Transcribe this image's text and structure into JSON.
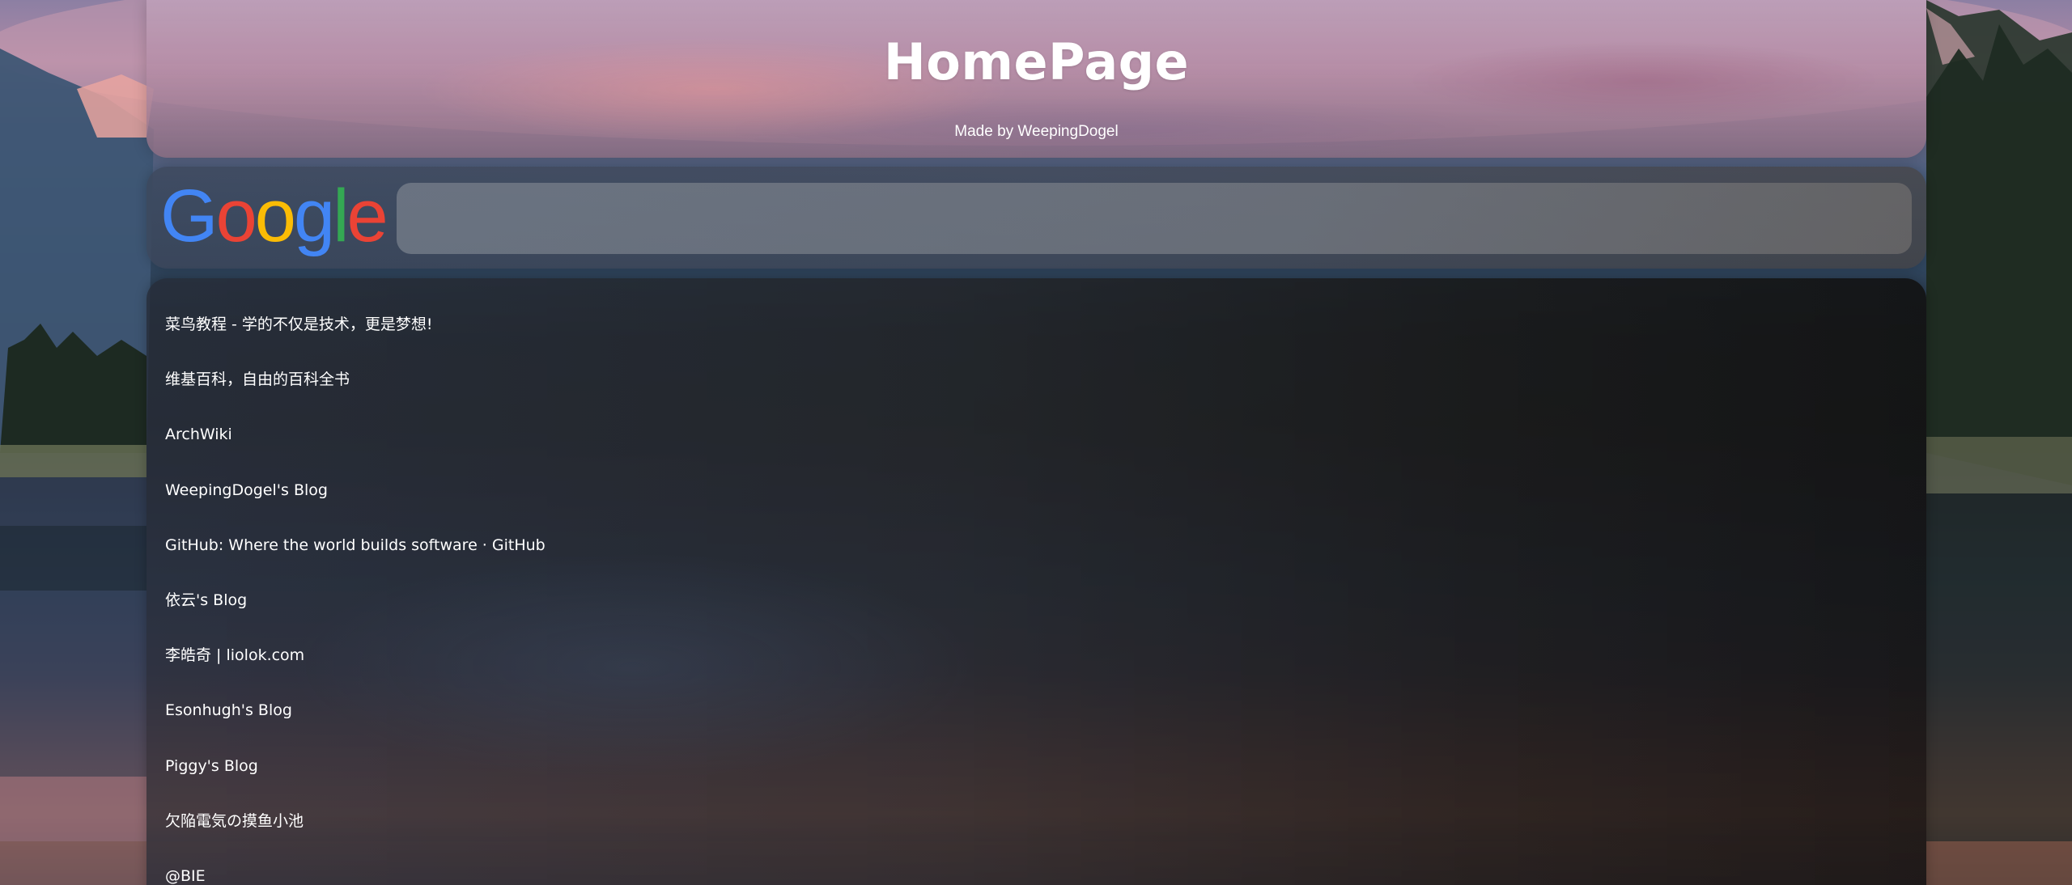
{
  "header": {
    "title": "HomePage",
    "subtitle": "Made by WeepingDogel"
  },
  "search": {
    "logo": "google-logo",
    "logo_text": "Google",
    "value": "",
    "placeholder": ""
  },
  "links": [
    {
      "label": "菜鸟教程 - 学的不仅是技术，更是梦想!"
    },
    {
      "label": "维基百科，自由的百科全书"
    },
    {
      "label": "ArchWiki"
    },
    {
      "label": "WeepingDogel's Blog"
    },
    {
      "label": "GitHub: Where the world builds software · GitHub"
    },
    {
      "label": "依云's Blog"
    },
    {
      "label": "李皓奇 | liolok.com"
    },
    {
      "label": "Esonhugh's Blog"
    },
    {
      "label": "Piggy's Blog"
    },
    {
      "label": "欠陥電気の摸鱼小池"
    },
    {
      "label": "@BIE"
    }
  ],
  "colors": {
    "google_blue": "#4285F4",
    "google_red": "#EA4335",
    "google_yellow": "#FBBC05",
    "google_green": "#34A853",
    "text": "#ffffff"
  }
}
